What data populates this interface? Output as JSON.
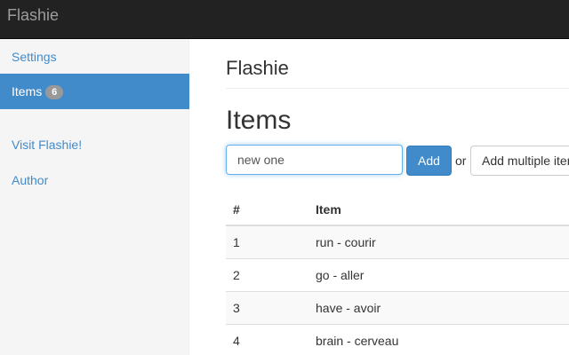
{
  "navbar": {
    "brand": "Flashie"
  },
  "sidebar": {
    "items": [
      {
        "label": "Settings"
      },
      {
        "label": "Items",
        "badge": "6"
      },
      {
        "label": "Visit Flashie!"
      },
      {
        "label": "Author"
      }
    ]
  },
  "main": {
    "site_title": "Flashie",
    "page_title": "Items",
    "form": {
      "input_value": "new one",
      "add_label": "Add",
      "or_label": "or",
      "multi_label": "Add multiple items"
    },
    "table": {
      "headers": [
        "#",
        "Item"
      ],
      "rows": [
        {
          "num": "1",
          "item": "run - courir"
        },
        {
          "num": "2",
          "item": "go - aller"
        },
        {
          "num": "3",
          "item": "have - avoir"
        },
        {
          "num": "4",
          "item": "brain - cerveau"
        }
      ]
    }
  },
  "colors": {
    "navbar_bg": "#222222",
    "accent": "#428bca",
    "sidebar_bg": "#f5f5f5"
  }
}
